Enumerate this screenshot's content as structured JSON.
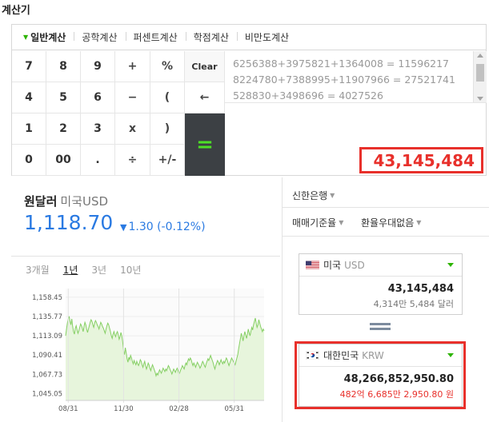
{
  "title": "계산기",
  "calculator": {
    "tabs": [
      {
        "label": "일반계산",
        "active": true
      },
      {
        "label": "공학계산"
      },
      {
        "label": "퍼센트계산"
      },
      {
        "label": "학점계산"
      },
      {
        "label": "비만도계산"
      }
    ],
    "keys": {
      "k7": "7",
      "k8": "8",
      "k9": "9",
      "plus": "+",
      "percent": "%",
      "clear": "Clear",
      "k4": "4",
      "k5": "5",
      "k6": "6",
      "minus": "−",
      "lparen": "(",
      "back": "←",
      "k1": "1",
      "k2": "2",
      "k3": "3",
      "times": "x",
      "rparen": ")",
      "k0": "0",
      "k00": "00",
      "dot": ".",
      "divide": "÷",
      "sign": "+/-",
      "equals": "="
    },
    "history": [
      "6256388+3975821+1364008 = 11596217",
      "8224780+7388995+11907966 = 27521741",
      "528830+3498696 = 4027526"
    ],
    "result": "43,145,484"
  },
  "exchange": {
    "title": "원달러",
    "subtitle": "미국USD",
    "rate": "1,118.70",
    "change": "1.30 (-0.12%)",
    "change_direction": "down",
    "periods": [
      "3개월",
      "1년",
      "3년",
      "10년"
    ],
    "active_period": "1년",
    "bank": "신한은행",
    "option_rate": "매매기준율",
    "option_pref": "환율우대없음",
    "from": {
      "country": "미국",
      "code": "USD",
      "value": "43,145,484",
      "korean": "4,314만 5,484 달러"
    },
    "to": {
      "country": "대한민국",
      "code": "KRW",
      "value": "48,266,852,950.80",
      "korean": "482억 6,685만 2,950.80 원"
    }
  },
  "colors": {
    "accent_green": "#2db400",
    "highlight_red": "#e8302b",
    "rate_blue": "#2a7ae2",
    "chart_fill": "#e7f5dc",
    "chart_line": "#85cf63"
  },
  "chart_data": {
    "type": "area",
    "ylim": [
      1037,
      1164
    ],
    "yticks": [
      "1,158.45",
      "1,135.77",
      "1,113.09",
      "1,090.41",
      "1,067.73",
      "1,045.05"
    ],
    "ytick_values": [
      1158.45,
      1135.77,
      1113.09,
      1090.41,
      1067.73,
      1045.05
    ],
    "xticks": [
      "08/31",
      "11/30",
      "02/28",
      "05/31"
    ],
    "xtick_index": [
      3,
      66,
      129,
      192
    ],
    "values": [
      1113,
      1121,
      1128,
      1133,
      1136,
      1130,
      1126,
      1133,
      1124,
      1118,
      1115,
      1122,
      1125,
      1120,
      1116,
      1119,
      1123,
      1127,
      1125,
      1122,
      1118,
      1124,
      1129,
      1126,
      1121,
      1117,
      1121,
      1125,
      1129,
      1132,
      1130,
      1126,
      1123,
      1128,
      1131,
      1129,
      1126,
      1124,
      1121,
      1125,
      1129,
      1127,
      1124,
      1122,
      1119,
      1116,
      1121,
      1125,
      1128,
      1126,
      1122,
      1118,
      1113,
      1110,
      1115,
      1118,
      1114,
      1112,
      1116,
      1118,
      1114,
      1109,
      1112,
      1117,
      1113,
      1106,
      1096,
      1091,
      1099,
      1093,
      1086,
      1082,
      1088,
      1085,
      1090,
      1087,
      1083,
      1080,
      1084,
      1081,
      1079,
      1083,
      1080,
      1078,
      1081,
      1085,
      1083,
      1079,
      1076,
      1080,
      1083,
      1078,
      1074,
      1077,
      1081,
      1079,
      1075,
      1072,
      1076,
      1079,
      1076,
      1073,
      1070,
      1066,
      1069,
      1067,
      1070,
      1073,
      1071,
      1069,
      1072,
      1075,
      1073,
      1071,
      1074,
      1072,
      1075,
      1078,
      1076,
      1073,
      1071,
      1068,
      1071,
      1074,
      1072,
      1070,
      1073,
      1075,
      1072,
      1068,
      1070,
      1073,
      1075,
      1078,
      1076,
      1074,
      1078,
      1081,
      1079,
      1083,
      1086,
      1084,
      1087,
      1085,
      1081,
      1078,
      1081,
      1079,
      1076,
      1079,
      1082,
      1080,
      1078,
      1075,
      1077,
      1080,
      1083,
      1081,
      1078,
      1076,
      1080,
      1083,
      1086,
      1084,
      1087,
      1090,
      1087,
      1084,
      1081,
      1077,
      1074,
      1078,
      1081,
      1084,
      1082,
      1079,
      1082,
      1085,
      1082,
      1080,
      1083,
      1081,
      1084,
      1087,
      1085,
      1081,
      1078,
      1081,
      1084,
      1087,
      1085,
      1083,
      1081,
      1079,
      1083,
      1087,
      1091,
      1098,
      1104,
      1110,
      1116,
      1112,
      1107,
      1113,
      1118,
      1114,
      1110,
      1115,
      1121,
      1117,
      1113,
      1118,
      1123,
      1120,
      1126,
      1130,
      1134,
      1128,
      1123,
      1126,
      1132,
      1128,
      1124,
      1121,
      1118,
      1121,
      1119
    ]
  }
}
